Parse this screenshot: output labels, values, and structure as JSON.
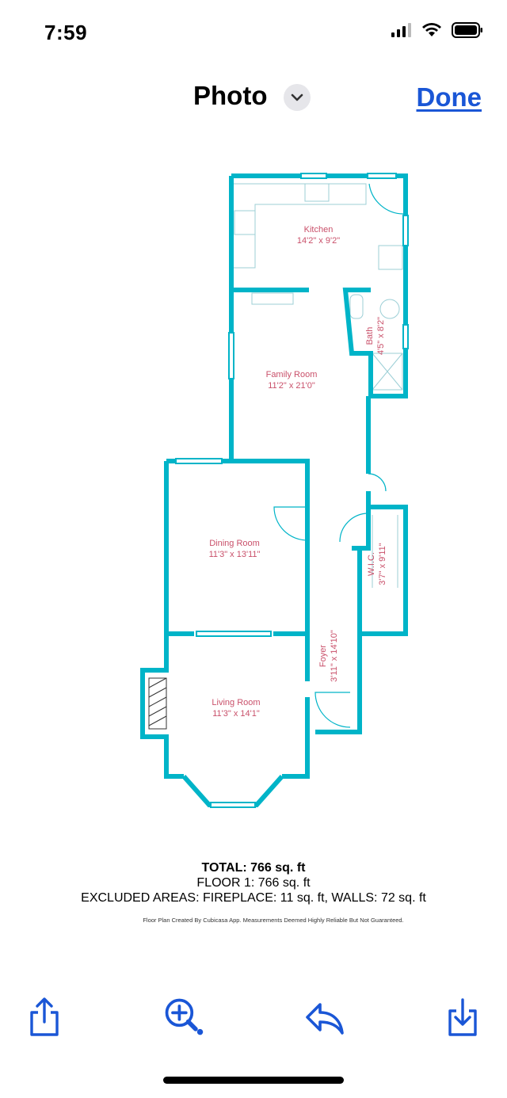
{
  "status_bar": {
    "time": "7:59",
    "icons": [
      "cellular-signal-icon",
      "wifi-icon",
      "battery-icon"
    ]
  },
  "nav": {
    "title": "Photo",
    "chevron_icon": "chevron-down-icon",
    "done_label": "Done"
  },
  "floor_plan": {
    "wall_color": "#00b4c8",
    "label_color": "#c9506a",
    "rooms": {
      "kitchen": {
        "name": "Kitchen",
        "dims": "14'2\" x 9'2\""
      },
      "family_room": {
        "name": "Family Room",
        "dims": "11'2\" x 21'0\""
      },
      "bath": {
        "name": "Bath",
        "dims": "4'5\" x 8'2\""
      },
      "dining_room": {
        "name": "Dining Room",
        "dims": "11'3\" x 13'11\""
      },
      "wic": {
        "name": "W.I.C.",
        "dims": "3'7\" x 9'11\""
      },
      "foyer": {
        "name": "Foyer",
        "dims": "3'11\" x 14'10\""
      },
      "living_room": {
        "name": "Living Room",
        "dims": "11'3\" x 14'1\""
      }
    }
  },
  "summary": {
    "total": "TOTAL: 766 sq. ft",
    "floor1": "FLOOR 1: 766 sq. ft",
    "excluded": "EXCLUDED AREAS: FIREPLACE: 11 sq. ft, WALLS: 72 sq. ft",
    "credit": "Floor Plan Created By Cubicasa App. Measurements Deemed Highly Reliable But Not Guaranteed."
  },
  "toolbar": {
    "icons": [
      "share-icon",
      "zoom-in-icon",
      "reply-icon",
      "download-icon"
    ],
    "accent": "#1a56d6"
  }
}
